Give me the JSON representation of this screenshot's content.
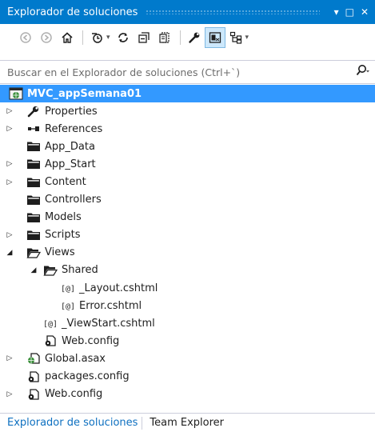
{
  "window": {
    "title": "Explorador de soluciones",
    "pin_glyph": "▾",
    "maximize_glyph": "□",
    "close_glyph": "✕"
  },
  "toolbar": {
    "tools": [
      {
        "name": "back-icon"
      },
      {
        "name": "forward-icon"
      },
      {
        "name": "home-icon"
      },
      {
        "name": "pending-changes-icon",
        "dropdown": true
      },
      {
        "name": "refresh-icon"
      },
      {
        "name": "collapse-all-icon"
      },
      {
        "name": "show-all-files-icon"
      },
      {
        "name": "properties-icon"
      },
      {
        "name": "preview-icon",
        "active": true
      },
      {
        "name": "class-view-icon",
        "dropdown": true
      }
    ]
  },
  "search": {
    "placeholder": "Buscar en el Explorador de soluciones (Ctrl+`)",
    "icon": "search-icon"
  },
  "tree": [
    {
      "label": "MVC_appSemana01",
      "icon": "web-project-icon",
      "level": 0,
      "expander": "none",
      "selected": true
    },
    {
      "label": "Properties",
      "icon": "wrench-icon",
      "level": 1,
      "expander": "collapsed"
    },
    {
      "label": "References",
      "icon": "references-icon",
      "level": 1,
      "expander": "collapsed"
    },
    {
      "label": "App_Data",
      "icon": "folder-icon",
      "level": 1,
      "expander": "none"
    },
    {
      "label": "App_Start",
      "icon": "folder-icon",
      "level": 1,
      "expander": "collapsed"
    },
    {
      "label": "Content",
      "icon": "folder-icon",
      "level": 1,
      "expander": "collapsed"
    },
    {
      "label": "Controllers",
      "icon": "folder-icon",
      "level": 1,
      "expander": "none"
    },
    {
      "label": "Models",
      "icon": "folder-icon",
      "level": 1,
      "expander": "none"
    },
    {
      "label": "Scripts",
      "icon": "folder-icon",
      "level": 1,
      "expander": "collapsed"
    },
    {
      "label": "Views",
      "icon": "folder-open-icon",
      "level": 1,
      "expander": "expanded"
    },
    {
      "label": "Shared",
      "icon": "folder-open-icon",
      "level": 2,
      "expander": "expanded"
    },
    {
      "label": "_Layout.cshtml",
      "icon": "razor-file-icon",
      "level": 3,
      "expander": "none"
    },
    {
      "label": "Error.cshtml",
      "icon": "razor-file-icon",
      "level": 3,
      "expander": "none"
    },
    {
      "label": "_ViewStart.cshtml",
      "icon": "razor-file-icon",
      "level": 2,
      "expander": "none"
    },
    {
      "label": "Web.config",
      "icon": "config-file-icon",
      "level": 2,
      "expander": "none"
    },
    {
      "label": "Global.asax",
      "icon": "global-asax-icon",
      "level": 1,
      "expander": "collapsed"
    },
    {
      "label": "packages.config",
      "icon": "config-file-icon",
      "level": 1,
      "expander": "none"
    },
    {
      "label": "Web.config",
      "icon": "config-file-icon",
      "level": 1,
      "expander": "collapsed"
    }
  ],
  "bottom_tabs": [
    {
      "label": "Explorador de soluciones",
      "active": true
    },
    {
      "label": "Team Explorer",
      "active": false
    }
  ],
  "colors": {
    "accent": "#007acc",
    "selection": "#3399ff",
    "active_tab_text": "#0e70c0"
  }
}
